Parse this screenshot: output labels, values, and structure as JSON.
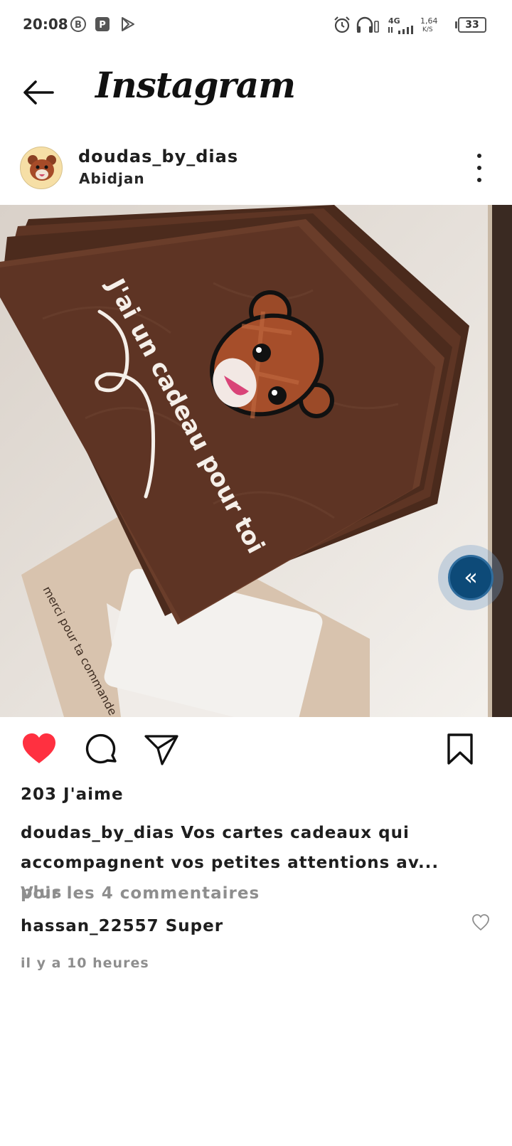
{
  "status_bar": {
    "time": "20:08",
    "network": "4G",
    "speed_value": "1,64",
    "speed_unit": "K/S",
    "battery": "33",
    "icons": [
      "b-circle-icon",
      "p-badge-icon",
      "play-store-icon",
      "alarm-icon",
      "headphones-icon",
      "signal-icon",
      "battery-icon"
    ]
  },
  "header": {
    "brand": "Instagram",
    "back_icon": "arrow-left-icon"
  },
  "post": {
    "username": "doudas_by_dias",
    "location": "Abidjan",
    "more_icon": "three-dots-vertical-icon",
    "photo": {
      "card_text": "J'ai un cadeau pour toi",
      "envelope_text": "merci pour ta commande"
    },
    "actions": {
      "like_icon": "heart-filled-icon",
      "comment_icon": "comment-bubble-icon",
      "share_icon": "paper-plane-icon",
      "save_icon": "bookmark-icon"
    },
    "likes": "203 J'aime",
    "caption": {
      "user": "doudas_by_dias",
      "text": " Vos cartes cadeaux qui accompagnent vos petites attentions av...",
      "more": " plus"
    },
    "view_comments": "Voir les 4 commentaires",
    "comment": {
      "user": "hassan_22557",
      "text": " Super"
    },
    "timestamp": "il y a 10 heures"
  },
  "colors": {
    "like_red": "#ff3040",
    "muted_gray": "#8e8e8e",
    "card_brown": "#5a3424",
    "float_button": "#0d4a78"
  }
}
